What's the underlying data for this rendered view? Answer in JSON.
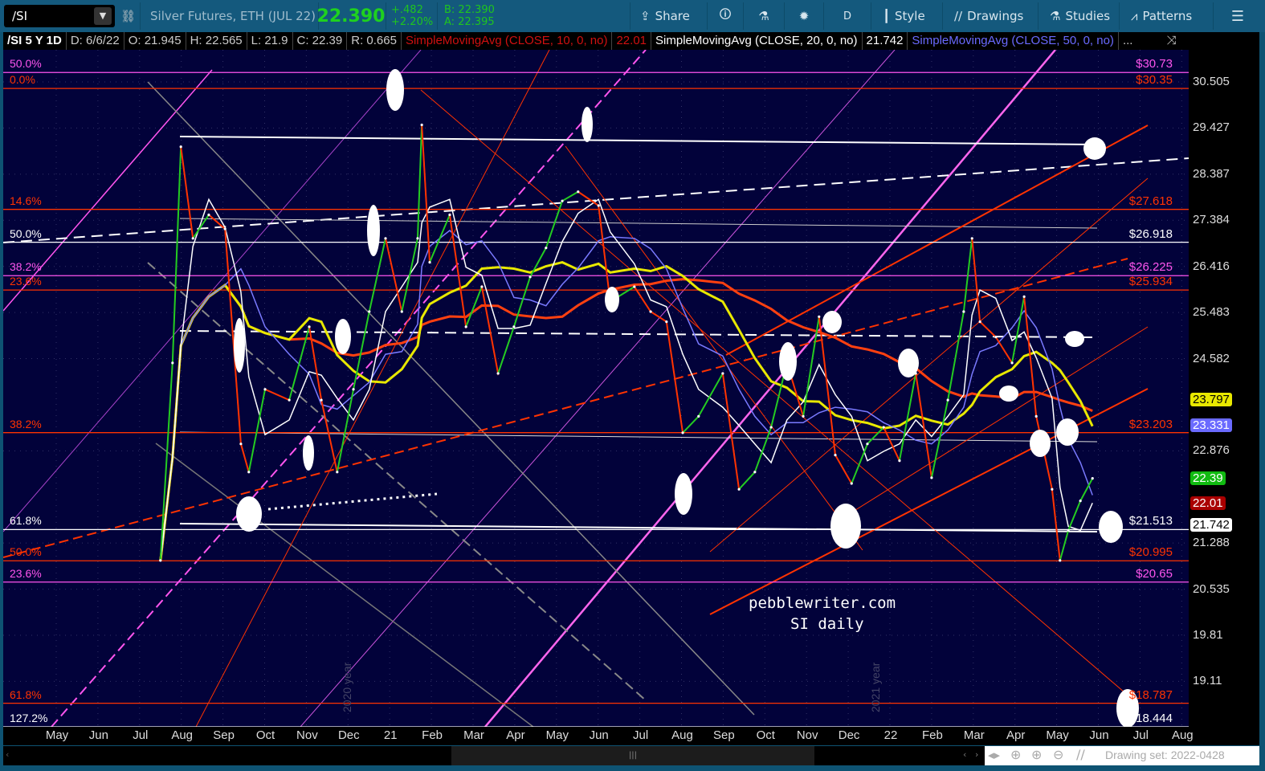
{
  "toolbar": {
    "symbol": "/SI",
    "description": "Silver Futures, ETH (JUL 22)",
    "last": "22.390",
    "change": "+.482",
    "change_pct": "+2.20%",
    "bid": "B: 22.390",
    "ask": "A: 22.395",
    "share": "Share",
    "aggregation": "D",
    "style": "Style",
    "drawings": "Drawings",
    "studies": "Studies",
    "patterns": "Patterns"
  },
  "infobar": {
    "chart_id": "/SI 5 Y 1D",
    "date": "D: 6/6/22",
    "open": "O: 21.945",
    "high": "H: 22.565",
    "low": "L: 21.9",
    "close": "C: 22.39",
    "range": "R: 0.665",
    "sma10_label": "SimpleMovingAvg (CLOSE, 10, 0, no)",
    "sma10_value": "22.01",
    "sma20_label": "SimpleMovingAvg (CLOSE, 20, 0, no)",
    "sma20_value": "21.742",
    "sma50_label": "SimpleMovingAvg (CLOSE, 50, 0, no)",
    "more": "..."
  },
  "colors": {
    "sma10": "#ff3b1f",
    "sma20": "#ffffff",
    "sma50": "#7a7aff",
    "sma_long": "#ff4010",
    "yellow": "#e8e800",
    "up": "#22cc22",
    "down": "#ff3300",
    "bg": "#02023a"
  },
  "chart_data": {
    "type": "line",
    "title": "/SI 5 Y 1D",
    "x_unit": "months since May 2020",
    "x_ticks": [
      "May",
      "Jun",
      "Jul",
      "Aug",
      "Sep",
      "Oct",
      "Nov",
      "Dec",
      "21",
      "Feb",
      "Mar",
      "Apr",
      "May",
      "Jun",
      "Jul",
      "Aug",
      "Sep",
      "Oct",
      "Nov",
      "Dec",
      "22",
      "Feb",
      "Mar",
      "Apr",
      "May",
      "Jun",
      "Jul",
      "Aug"
    ],
    "y_scale": "log",
    "ylim": [
      18.3,
      31.2
    ],
    "y_ticks": [
      "30.505",
      "29.427",
      "28.387",
      "27.384",
      "26.416",
      "25.483",
      "24.582",
      "22.876",
      "21.288",
      "20.535",
      "19.81",
      "19.11"
    ],
    "close": {
      "x": [
        2.5,
        2.79,
        2.99,
        3.28,
        3.66,
        4.05,
        4.43,
        4.62,
        5.01,
        5.59,
        6.07,
        6.36,
        6.74,
        7.13,
        7.51,
        7.9,
        8.29,
        8.67,
        8.77,
        8.96,
        9.44,
        9.83,
        10.21,
        10.6,
        10.98,
        11.37,
        11.75,
        12.14,
        12.52,
        13.01,
        13.29,
        13.87,
        14.26,
        14.64,
        15.03,
        15.41,
        15.99,
        16.38,
        16.76,
        17.15,
        17.53,
        17.92,
        18.3,
        18.69,
        19.08,
        19.46,
        19.85,
        20.23,
        20.62,
        21.0,
        21.39,
        21.77,
        21.97,
        22.16,
        22.54,
        22.93,
        23.22,
        23.51,
        23.89,
        24.08,
        24.28,
        24.57,
        24.86
      ],
      "y": [
        21,
        24.5,
        29,
        27,
        27.5,
        27.2,
        23,
        22.5,
        24,
        23.8,
        25.2,
        23.8,
        22.5,
        24,
        25.5,
        27,
        25.5,
        27,
        29.5,
        26.5,
        27.5,
        25.2,
        26,
        24.3,
        25.2,
        26.2,
        26.8,
        27.8,
        28,
        27.7,
        25.7,
        26,
        25.5,
        25.3,
        23.2,
        23.5,
        24.3,
        22.2,
        22.5,
        23.3,
        24.5,
        23.5,
        25.4,
        22.8,
        22.3,
        23,
        23.3,
        22.7,
        24.3,
        22.4,
        23.8,
        25.5,
        27,
        25.3,
        25,
        24.5,
        25.8,
        23.5,
        22.2,
        21,
        21.5,
        22,
        22.39
      ]
    },
    "moving_averages": [
      {
        "name": "SimpleMovingAvg (CLOSE, 10, 0, no)",
        "window_points": 1,
        "color": "#ff3b1f"
      },
      {
        "name": "SimpleMovingAvg (CLOSE, 20, 0, no)",
        "window_points": 3,
        "color": "#ffffff"
      },
      {
        "name": "SimpleMovingAvg (CLOSE, 50, 0, no)",
        "window_points": 6,
        "color": "#7a7aff"
      },
      {
        "window_points": 10,
        "color": "#e8e800"
      },
      {
        "window_points": 22,
        "color": "#ff4010"
      }
    ],
    "levels": [
      {
        "pct": "50.0%",
        "price": 30.73,
        "label": "$30.73",
        "color": "#ff55ee"
      },
      {
        "pct": "0.0%",
        "price": 30.35,
        "label": "$30.35",
        "color": "#ff3300"
      },
      {
        "pct": "14.6%",
        "price": 27.618,
        "label": "$27.618",
        "color": "#ff3300"
      },
      {
        "pct": "50.0%",
        "price": 26.918,
        "label": "$26.918",
        "color": "#ffffff"
      },
      {
        "pct": "38.2%",
        "price": 26.225,
        "label": "$26.225",
        "color": "#ff55ee"
      },
      {
        "pct": "23.6%",
        "price": 25.934,
        "label": "$25.934",
        "color": "#ff3300"
      },
      {
        "pct": "38.2%",
        "price": 23.203,
        "label": "$23.203",
        "color": "#ff3300"
      },
      {
        "pct": "61.8%",
        "price": 21.513,
        "label": "$21.513",
        "color": "#ffffff"
      },
      {
        "pct": "50.0%",
        "price": 20.995,
        "label": "$20.995",
        "color": "#ff3300"
      },
      {
        "pct": "23.6%",
        "price": 20.65,
        "label": "$20.65",
        "color": "#ff55ee"
      },
      {
        "pct": "61.8%",
        "price": 18.787,
        "label": "$18.787",
        "color": "#ff3300"
      },
      {
        "pct": "127.2%",
        "price": 18.444,
        "label": "$18.444",
        "color": "#ffffff"
      }
    ],
    "price_badges": [
      {
        "value": "23.797",
        "price": 23.797,
        "bg": "#e8e800",
        "fg": "#000"
      },
      {
        "value": "23.331",
        "price": 23.331,
        "bg": "#6a6aff",
        "fg": "#fff"
      },
      {
        "value": "22.39",
        "price": 22.39,
        "bg": "#11bb11",
        "fg": "#fff"
      },
      {
        "value": "22.01",
        "price": 22.01,
        "bg": "#aa0000",
        "fg": "#fff"
      },
      {
        "value": "21.742",
        "price": 21.742,
        "bg": "#ffffff",
        "fg": "#000"
      }
    ],
    "annotations": {
      "watermark1": "pebblewriter.com",
      "watermark2": "SI daily",
      "year1": "2020 year",
      "year2": "2021 year"
    }
  },
  "statusbar": {
    "drawing_set": "Drawing set: 2022-0428"
  }
}
